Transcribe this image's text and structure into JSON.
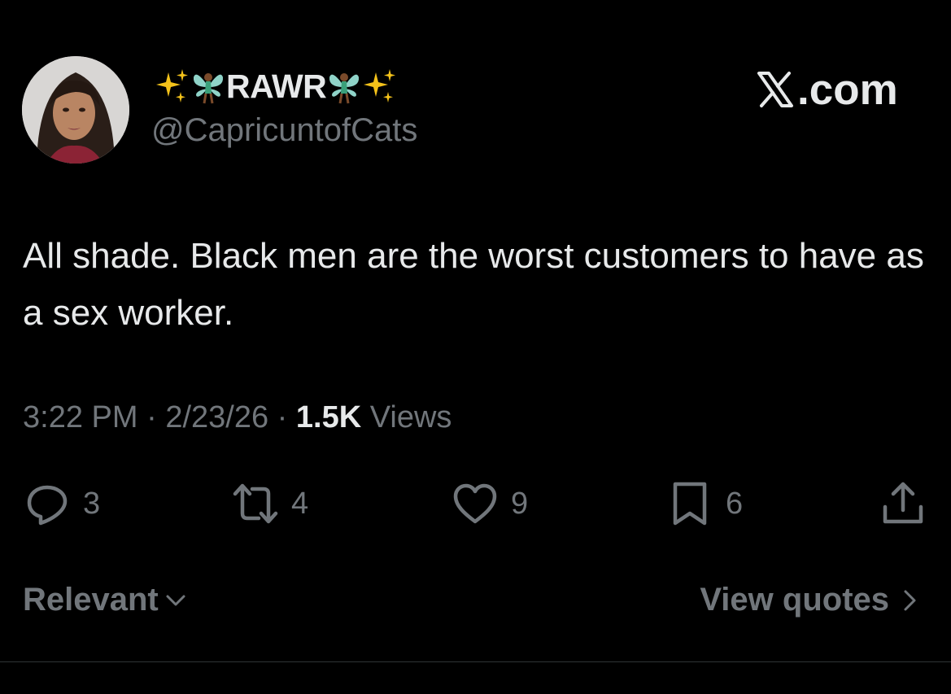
{
  "author": {
    "display_name": "RAWR",
    "handle": "@CapricuntofCats",
    "name_emojis": [
      "sparkles-icon",
      "fairy-icon",
      "fairy-icon",
      "sparkles-icon"
    ]
  },
  "brand": {
    "label": ".com",
    "logo": "x-logo-icon"
  },
  "tweet": {
    "text": "All shade. Black men are the worst customers to have as a sex worker.",
    "time": "3:22 PM",
    "date": "2/23/26",
    "separator": "·",
    "views_count": "1.5K",
    "views_label": "Views"
  },
  "actions": {
    "replies": "3",
    "reposts": "4",
    "likes": "9",
    "bookmarks": "6"
  },
  "footer": {
    "sort_label": "Relevant",
    "quotes_label": "View quotes"
  },
  "colors": {
    "background": "#000000",
    "text_primary": "#e7e9ea",
    "text_secondary": "#71767b",
    "divider": "#2f3336"
  }
}
